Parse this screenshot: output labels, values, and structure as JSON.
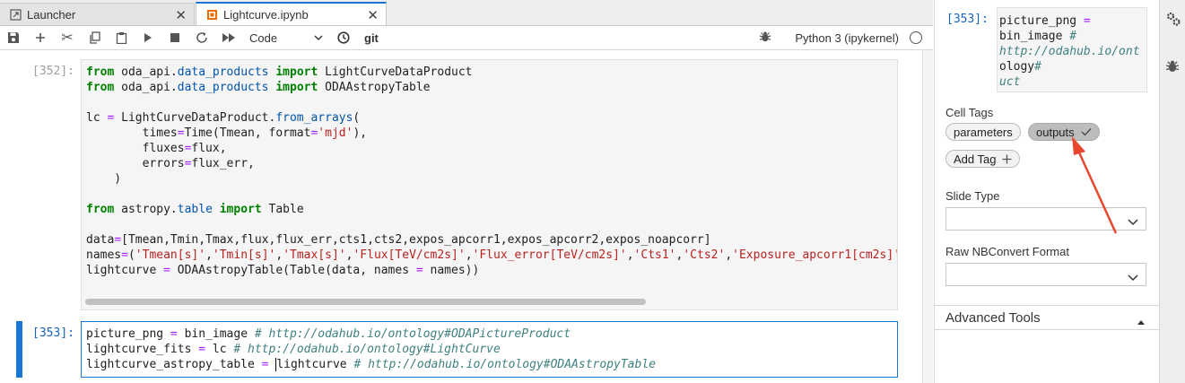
{
  "tabs": [
    {
      "label": "Launcher",
      "icon": "launcher-icon"
    },
    {
      "label": "Lightcurve.ipynb",
      "icon": "notebook-icon"
    }
  ],
  "toolbar": {
    "cell_type": "Code",
    "git_label": "git",
    "kernel_name": "Python 3 (ipykernel)"
  },
  "cells": [
    {
      "prompt": "[352]:",
      "lines": [
        "from oda_api.data_products import LightCurveDataProduct",
        "from oda_api.data_products import ODAAstropyTable",
        "",
        "lc = LightCurveDataProduct.from_arrays(",
        "        times=Time(Tmean, format='mjd'),",
        "        fluxes=flux,",
        "        errors=flux_err,",
        "    )",
        "",
        "from astropy.table import Table",
        "",
        "data=[Tmean,Tmin,Tmax,flux,flux_err,cts1,cts2,expos_apcorr1,expos_apcorr2,expos_noapcorr]",
        "names=('Tmean[s]','Tmin[s]','Tmax[s]','Flux[TeV/cm2s]','Flux_error[TeV/cm2s]','Cts1','Cts2','Exposure_apcorr1[cm2s]'",
        "lightcurve = ODAAstropyTable(Table(data, names = names))"
      ]
    },
    {
      "prompt": "[353]:",
      "lines": [
        "picture_png = bin_image # http://odahub.io/ontology#ODAPictureProduct",
        "lightcurve_fits = lc # http://odahub.io/ontology#LightCurve",
        "lightcurve_astropy_table = lightcurve # http://odahub.io/ontology#ODAAstropyTable"
      ]
    }
  ],
  "property_inspector": {
    "cell_prompt": "[353]:",
    "cell_preview_lines": [
      "picture_png =",
      "bin_image #",
      "http://odahub.io/ont",
      "ology#ODAPictureProd",
      "uct"
    ],
    "cell_tags_label": "Cell Tags",
    "tags": [
      {
        "label": "parameters",
        "selected": false
      },
      {
        "label": "outputs",
        "selected": true
      }
    ],
    "add_tag_label": "Add Tag",
    "slide_type_label": "Slide Type",
    "slide_type_value": "",
    "raw_format_label": "Raw NBConvert Format",
    "raw_format_value": "",
    "advanced_tools_label": "Advanced Tools"
  },
  "colors": {
    "accent": "#1976d2",
    "annotation_arrow": "#e8472f"
  }
}
